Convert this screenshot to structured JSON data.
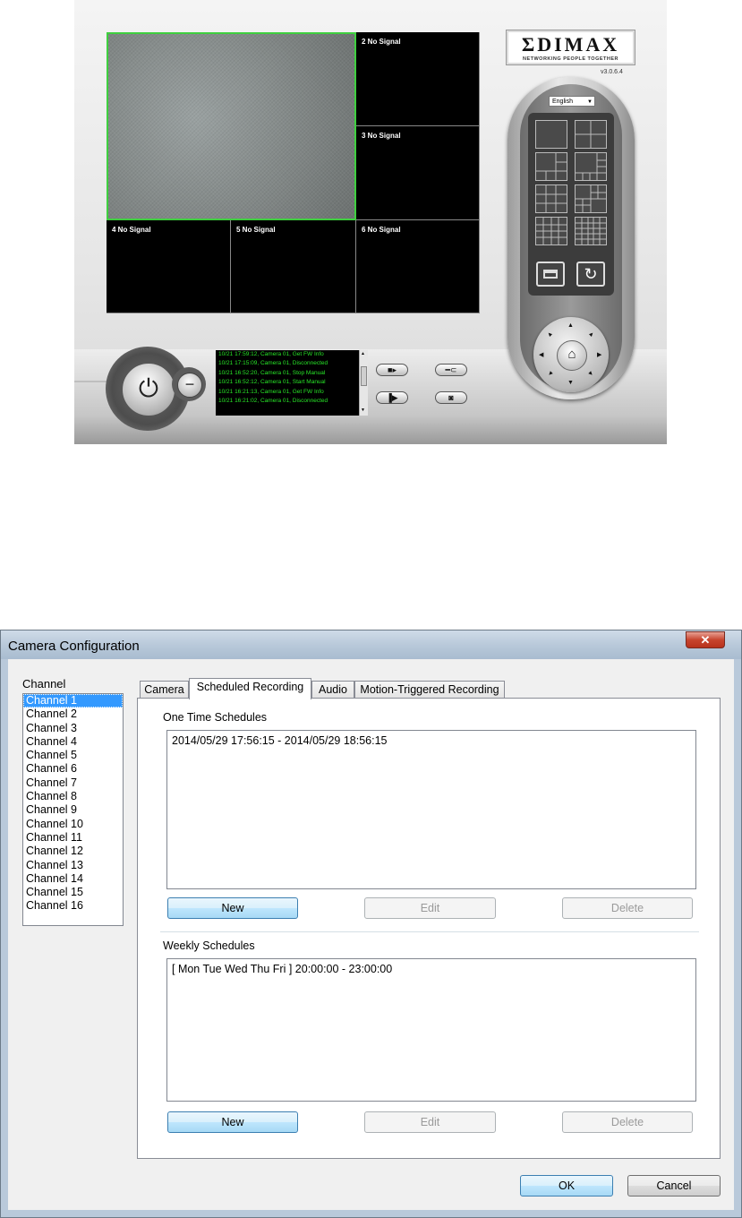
{
  "viewer": {
    "cameras": [
      {
        "label": ""
      },
      {
        "label": "2 No Signal"
      },
      {
        "label": "3 No Signal"
      },
      {
        "label": "4 No Signal"
      },
      {
        "label": "5 No Signal"
      },
      {
        "label": "6 No Signal"
      }
    ],
    "logo": "ΣDIMAX",
    "logo_tagline": "NETWORKING PEOPLE TOGETHER",
    "version": "v3.0.6.4",
    "language": "English",
    "event_log": [
      "10/21 17:59:12, Camera 01, Get FW Info",
      "10/21 17:15:09, Camera 01, Disconnected",
      "10/21 16:52:20, Camera 01, Stop Manual",
      "10/21 16:52:12, Camera 01, Start Manual",
      "10/21 16:21:13, Camera 01, Get FW Info",
      "10/21 16:21:02, Camera 01, Disconnected"
    ],
    "colors": {
      "active_border": "#3fcf3f",
      "log_text": "#27e427"
    },
    "icons": [
      "power-icon",
      "minimize-icon",
      "record-icon",
      "settings-icon",
      "playback-icon",
      "snapshot-icon",
      "home-icon",
      "refresh-icon",
      "window-icon"
    ]
  },
  "dialog": {
    "title": "Camera Configuration",
    "close_glyph": "✕",
    "channel_label": "Channel",
    "channels": [
      "Channel 1",
      "Channel 2",
      "Channel 3",
      "Channel 4",
      "Channel 5",
      "Channel 6",
      "Channel 7",
      "Channel 8",
      "Channel 9",
      "Channel 10",
      "Channel 11",
      "Channel 12",
      "Channel 13",
      "Channel 14",
      "Channel 15",
      "Channel 16"
    ],
    "selected_channel": "Channel 1",
    "tabs": [
      "Camera",
      "Scheduled Recording",
      "Audio",
      "Motion-Triggered Recording"
    ],
    "active_tab": "Scheduled Recording",
    "one_time": {
      "label": "One Time Schedules",
      "entries": [
        "2014/05/29 17:56:15 - 2014/05/29 18:56:15"
      ],
      "new": "New",
      "edit": "Edit",
      "delete": "Delete"
    },
    "weekly": {
      "label": "Weekly Schedules",
      "entries": [
        "[ Mon Tue Wed Thu Fri ] 20:00:00 - 23:00:00"
      ],
      "new": "New",
      "edit": "Edit",
      "delete": "Delete"
    },
    "ok": "OK",
    "cancel": "Cancel",
    "colors": {
      "selection": "#3399ff",
      "close_button": "#c7442e"
    }
  }
}
